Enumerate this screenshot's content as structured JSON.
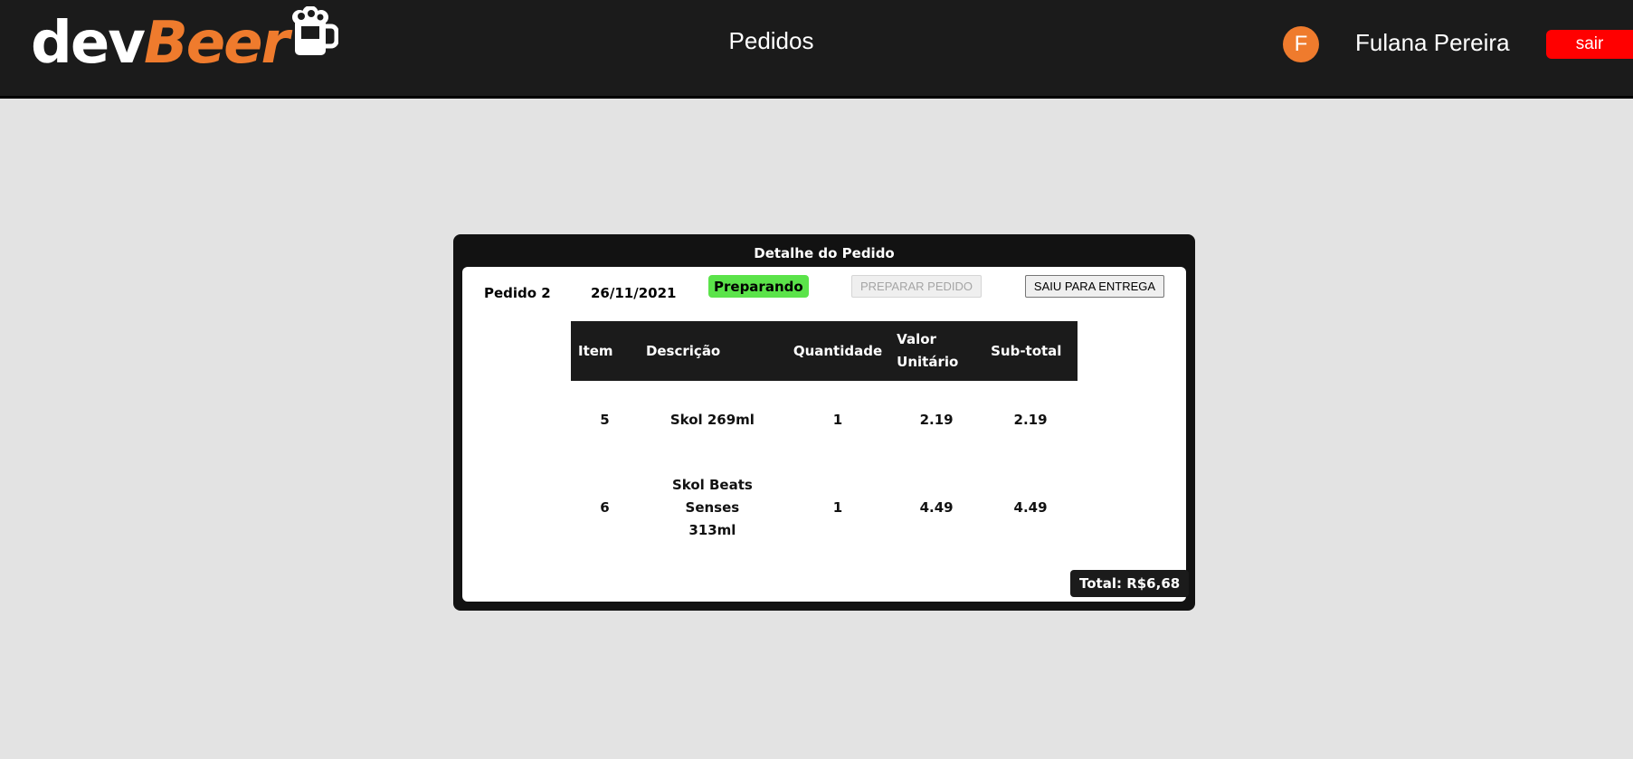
{
  "header": {
    "logo_dev": "dev",
    "logo_beer": "Beer",
    "logo_icon": "beer-mug-icon",
    "nav_title": "Pedidos",
    "avatar_initial": "F",
    "user_name": "Fulana Pereira",
    "logout_label": "sair"
  },
  "colors": {
    "topbar": "#1b1b1b",
    "accent": "#ef7b2d",
    "logout": "#ff0000",
    "status_preparing": "#5be34a",
    "page_bg": "#e3e3e3"
  },
  "order": {
    "title": "Detalhe do Pedido",
    "order_label": "Pedido 2",
    "date": "26/11/2021",
    "status": "Preparando",
    "prepare_button": "PREPARAR PEDIDO",
    "deliver_button": "SAIU PARA ENTREGA",
    "columns": [
      "Item",
      "Descrição",
      "Quantidade",
      "Valor Unitário",
      "Sub-total"
    ],
    "items": [
      {
        "item": "5",
        "description": "Skol 269ml",
        "quantity": "1",
        "unit_price": "2.19",
        "subtotal": "2.19"
      },
      {
        "item": "6",
        "description": "Skol Beats Senses 313ml",
        "quantity": "1",
        "unit_price": "4.49",
        "subtotal": "4.49"
      }
    ],
    "total": "Total: R$6,68"
  }
}
